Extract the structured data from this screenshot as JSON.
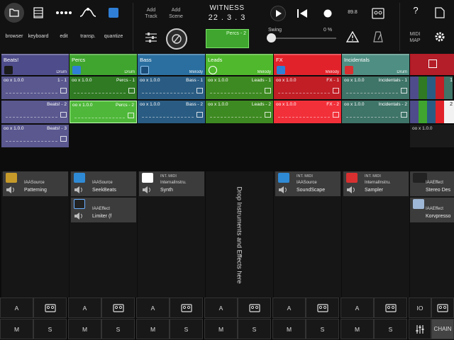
{
  "toolbar": {
    "tools": [
      {
        "label": "browser",
        "icon": "browser-icon"
      },
      {
        "label": "keyboard",
        "icon": "keyboard-icon"
      },
      {
        "label": "edit",
        "icon": "edit-icon"
      },
      {
        "label": "transp.",
        "icon": "transpose-icon"
      },
      {
        "label": "quantize",
        "icon": "quantize-icon"
      }
    ],
    "add_track": "Add\nTrack",
    "add_scene": "Add\nScene",
    "song_name": "WITNESS",
    "song_position": "22 . 3 . 3",
    "current_clip": "Percs - 2",
    "swing_label": "Swing",
    "swing_value": "0 %",
    "swing_percent": 0,
    "tempo": "89.8",
    "midi_map": "MIDI\nMAP",
    "help": "?"
  },
  "scenes": [
    {
      "name": "Beats!",
      "kind": "Drum",
      "color": "#4e4c8a",
      "clip_color": "#5a588f",
      "clips": [
        {
          "len": "oo x 1.0.0",
          "name": "1 - 1"
        },
        {
          "len": "",
          "name": "Beats! - 2"
        },
        {
          "len": "oo x 1.0.0",
          "name": "Beats! - 3"
        }
      ],
      "devices": [
        {
          "type": "IAASource",
          "name": "Patterning",
          "logo": "#c69a2a"
        }
      ],
      "a": "A",
      "m": "M",
      "s": "S"
    },
    {
      "name": "Percs",
      "kind": "Drum",
      "color": "#3fa52e",
      "clip_color": "#2f7a23",
      "clips": [
        {
          "len": "oo x 1.0.0",
          "name": "Percs - 1"
        },
        {
          "len": "oo x 1.0.0",
          "name": "Percs - 2"
        }
      ],
      "devices": [
        {
          "type": "IAASource",
          "name": "SeekBeats",
          "logo": "#2f8ad6"
        },
        {
          "type": "IAAEffect",
          "name": "Limiter (f",
          "logo": "#333"
        }
      ],
      "a": "A",
      "m": "M",
      "s": "S"
    },
    {
      "name": "Bass",
      "kind": "Melody",
      "color": "#2a6fa0",
      "clip_color": "#2a5c83",
      "clips": [
        {
          "len": "oo x 1.0.0",
          "name": "Bass - 1"
        },
        {
          "len": "oo x 1.0.0",
          "name": "Bass - 2"
        }
      ],
      "devices": [
        {
          "type": "InternalInstru.",
          "name": "Synth",
          "small": "INT. MIDI",
          "logo": "#fff"
        }
      ],
      "a": "A",
      "m": "M",
      "s": "S"
    },
    {
      "name": "Leads",
      "kind": "Melody",
      "color": "#4fb82c",
      "clip_color": "#3e8a22",
      "clips": [
        {
          "len": "oo x 1.0.0",
          "name": "Leads - 1"
        },
        {
          "len": "oo x 1.0.0",
          "name": "Leads - 2"
        }
      ],
      "devices": [],
      "drop_text": "Drop Instruments and Effects here",
      "a": "A",
      "m": "M",
      "s": "S"
    },
    {
      "name": "FX",
      "kind": "Melody",
      "color": "#e2222a",
      "clip_color": "#c11e26",
      "clips": [
        {
          "len": "oo x 1.0.0",
          "name": "FX - 1"
        },
        {
          "len": "oo x 1.0.0",
          "name": "FX - 2"
        }
      ],
      "devices": [
        {
          "type": "IAASource",
          "name": "SoundScape",
          "small": "INT. MIDI",
          "logo": "#2f8ad6"
        }
      ],
      "a": "A",
      "m": "M",
      "s": "S"
    },
    {
      "name": "Incidentals",
      "kind": "Drum",
      "color": "#4f8f83",
      "clip_color": "#3f7468",
      "clips": [
        {
          "len": "oo x 1.0.0",
          "name": "Incidentals - 1"
        },
        {
          "len": "oo x 1.0.0",
          "name": "Incidentals - 2"
        }
      ],
      "devices": [
        {
          "type": "InternalInstru.",
          "name": "Sampler",
          "small": "INT. MIDI",
          "logo": "#d83030"
        }
      ],
      "a": "A",
      "m": "M",
      "s": "S"
    }
  ],
  "master": {
    "clip_numbers": [
      "1",
      "2"
    ],
    "clip_len": "oo x 1.0.0",
    "devices": [
      {
        "type": "IAAEffect",
        "name": "Stereo Des"
      },
      {
        "type": "IAAEffect",
        "name": "Korvpresso"
      }
    ],
    "io": "IO",
    "chain": "CHAIN"
  }
}
